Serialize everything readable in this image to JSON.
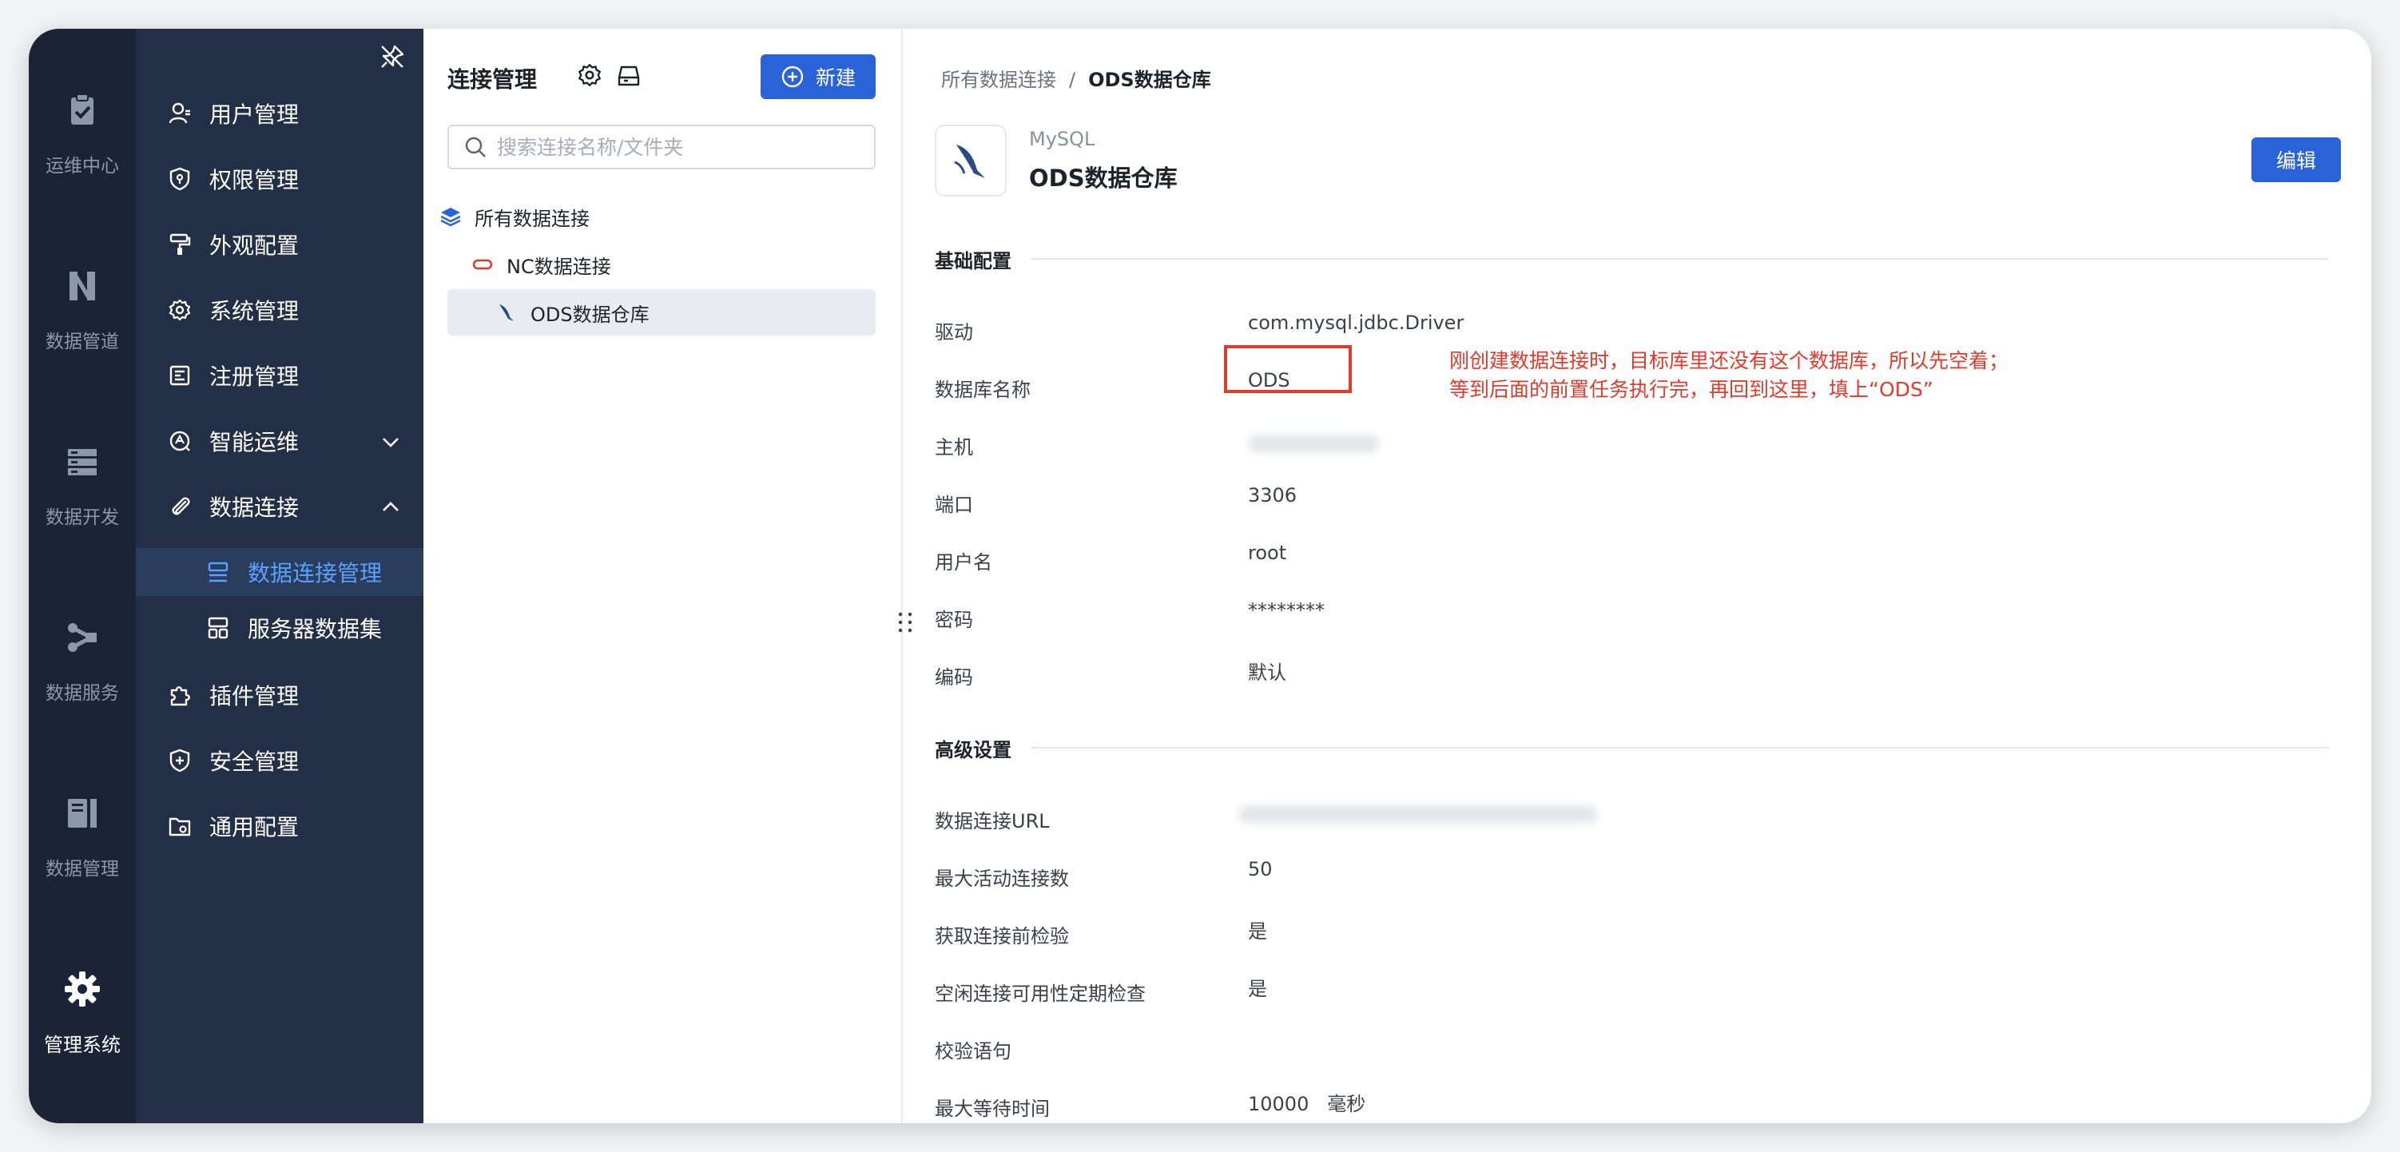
{
  "rail": {
    "items": [
      {
        "label": "运维中心",
        "icon": "clipboard-check-icon"
      },
      {
        "label": "数据管道",
        "icon": "pipeline-icon"
      },
      {
        "label": "数据开发",
        "icon": "server-stack-icon"
      },
      {
        "label": "数据服务",
        "icon": "flow-icon"
      },
      {
        "label": "数据管理",
        "icon": "book-icon"
      },
      {
        "label": "管理系统",
        "icon": "gear-icon"
      }
    ]
  },
  "nav": {
    "items": [
      {
        "label": "用户管理",
        "icon": "user-icon"
      },
      {
        "label": "权限管理",
        "icon": "shield-icon"
      },
      {
        "label": "外观配置",
        "icon": "paint-roller-icon"
      },
      {
        "label": "系统管理",
        "icon": "gear-icon"
      },
      {
        "label": "注册管理",
        "icon": "register-icon"
      },
      {
        "label": "智能运维",
        "icon": "ai-ops-icon"
      },
      {
        "label": "数据连接",
        "icon": "paperclip-icon"
      },
      {
        "label": "数据连接管理",
        "icon": "connection-icon"
      },
      {
        "label": "服务器数据集",
        "icon": "server-dataset-icon"
      },
      {
        "label": "插件管理",
        "icon": "puzzle-icon"
      },
      {
        "label": "安全管理",
        "icon": "shield-plus-icon"
      },
      {
        "label": "通用配置",
        "icon": "folder-gear-icon"
      }
    ]
  },
  "middle": {
    "title": "连接管理",
    "new_label": "新建",
    "search_placeholder": "搜索连接名称/文件夹",
    "tree": [
      {
        "label": "所有数据连接",
        "icon": "layers-icon"
      },
      {
        "label": "NC数据连接",
        "icon": "oracle-icon"
      },
      {
        "label": "ODS数据仓库",
        "icon": "mysql-icon"
      }
    ]
  },
  "detail": {
    "breadcrumb": {
      "root": "所有数据连接",
      "sep": "/",
      "current": "ODS数据仓库"
    },
    "db_type": "MySQL",
    "db_name": "ODS数据仓库",
    "edit_label": "编辑",
    "sections": {
      "basic": "基础配置",
      "advanced": "高级设置"
    },
    "basic_fields": [
      {
        "label": "驱动",
        "value": "com.mysql.jdbc.Driver"
      },
      {
        "label": "数据库名称",
        "value": "ODS"
      },
      {
        "label": "主机",
        "value": ""
      },
      {
        "label": "端口",
        "value": "3306"
      },
      {
        "label": "用户名",
        "value": "root"
      },
      {
        "label": "密码",
        "value": "********"
      },
      {
        "label": "编码",
        "value": "默认"
      }
    ],
    "advanced_fields": [
      {
        "label": "数据连接URL",
        "value": ""
      },
      {
        "label": "最大活动连接数",
        "value": "50"
      },
      {
        "label": "获取连接前检验",
        "value": "是"
      },
      {
        "label": "空闲连接可用性定期检查",
        "value": "是"
      },
      {
        "label": "校验语句",
        "value": ""
      },
      {
        "label": "最大等待时间",
        "value": "10000   毫秒"
      }
    ],
    "annotation": {
      "line1": "刚创建数据连接时，目标库里还没有这个数据库，所以先空着；",
      "line2": "等到后面的前置任务执行完，再回到这里，填上“ODS”"
    }
  },
  "colors": {
    "accent": "#2a63d8",
    "rail_bg": "#1b2437",
    "nav_bg": "#232f46",
    "annotation": "#e23a2b",
    "nav_selected_text": "#5aa1ff"
  }
}
